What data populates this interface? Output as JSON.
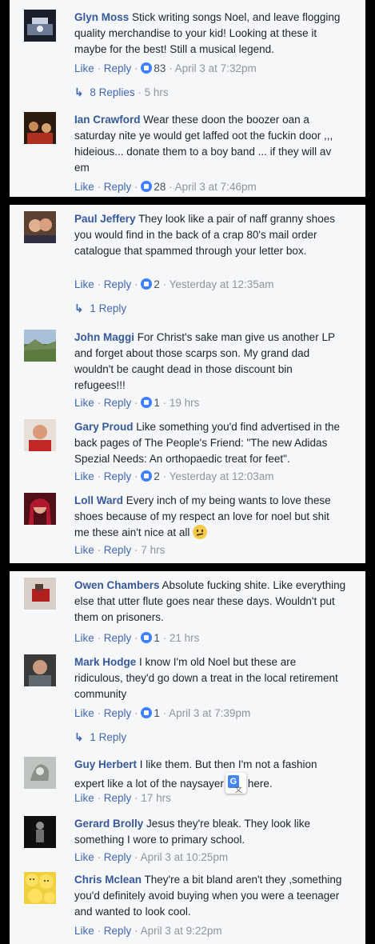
{
  "ui": {
    "like": "Like",
    "reply": "Reply",
    "sep": "·"
  },
  "colors": {
    "link": "#365899",
    "action": "#4267b2",
    "meta": "#90949c",
    "panel": "#f6f7f9",
    "gap": "#000000"
  },
  "comments": [
    {
      "name": "Glyn Moss",
      "text": "Stick writing songs Noel, and leave flogging quality merchandise to your kid! Looking at these it maybe for the best! Still a musical legend.",
      "likes": "83",
      "time": "April 3 at 7:32pm",
      "replies": "8 Replies",
      "replies_time": "5 hrs",
      "avatar_icon": "stage-photo"
    },
    {
      "name": "Ian Crawford",
      "text": "Wear these doon the boozer oan a saturday nite ye would get laffed oot the fuckin door ,,, hideious... donate them to a boy band ... if they will av em",
      "likes": "28",
      "time": "April 3 at 7:46pm",
      "avatar_icon": "band-photo"
    },
    {
      "name": "Paul Jeffery",
      "text": "They look like a pair of naff granny shoes you would find in the back of a crap 80's mail order catalogue that spammed through your letter box.",
      "likes": "2",
      "time": "Yesterday at 12:35am",
      "replies": "1 Reply",
      "avatar_icon": "couple-photo"
    },
    {
      "name": "John Maggi",
      "text": "For Christ's sake man give us another LP and forget about those scarps son. My grand dad wouldn't be caught dead in those discount bin refugees!!!",
      "likes": "1",
      "time": "19 hrs",
      "avatar_icon": "landscape-photo"
    },
    {
      "name": "Gary Proud",
      "text": "Like something you'd find advertised in the back pages of The People's Friend: \"The new Adidas Spezial Needs: An orthopaedic treat for feet\".",
      "likes": "2",
      "time": "Yesterday at 12:03am",
      "avatar_icon": "man-red-shirt"
    },
    {
      "name": "Loll Ward",
      "text": "Every inch of my being wants to love these shoes because of my respect an love for noel but shit me these ain't nice at all",
      "emoji": "confused-emoji",
      "time": "7 hrs",
      "avatar_icon": "red-hair-woman"
    },
    {
      "name": "Owen Chambers",
      "text": "Absolute fucking shite. Like everything else that utter flute goes near these days. Wouldn't put them on prisoners.",
      "likes": "1",
      "time": "21 hrs",
      "avatar_icon": "red-object-photo"
    },
    {
      "name": "Mark Hodge",
      "text": "I know I'm old Noel but these are ridiculous, they'd go down a treat in the local retirement community",
      "likes": "1",
      "time": "April 3 at 7:39pm",
      "replies": "1 Reply",
      "avatar_icon": "man-photo"
    },
    {
      "name": "Guy Herbert",
      "text_a": "I like them. But then I'm not a fashion expert like a lot of the naysayer",
      "text_b": "here.",
      "time": "17 hrs",
      "avatar_icon": "grey-drawing"
    },
    {
      "name": "Gerard Brolly",
      "text": "Jesus they're bleak. They look like something I wore to primary school.",
      "time": "April 3 at 10:25pm",
      "avatar_icon": "dark-figure"
    },
    {
      "name": "Chris Mclean",
      "text": "They're a bit bland aren't they ,something you'd definitely avoid buying when you were a teenager and wanted to look cool.",
      "time": "April 3 at 9:22pm",
      "avatar_icon": "smiley-faces"
    }
  ]
}
